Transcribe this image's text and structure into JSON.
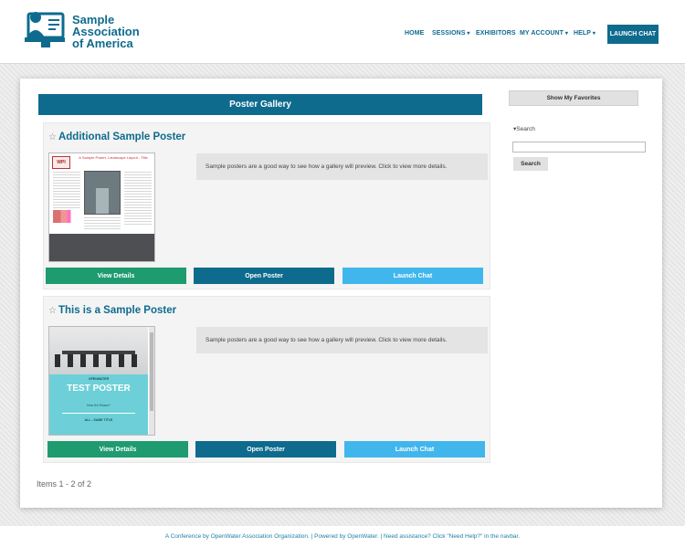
{
  "brand": {
    "name_line1": "Sample",
    "name_line2": "Association",
    "name_line3": "of America",
    "color": "#0e6b8e"
  },
  "nav": {
    "home": "HOME",
    "sessions": "SESSIONS",
    "exhibitors": "EXHIBITORS",
    "my_account": "MY ACCOUNT",
    "help": "HELP",
    "launch_chat": "LAUNCH CHAT"
  },
  "gallery": {
    "title": "Poster Gallery",
    "items_count": "Items 1 - 2 of 2",
    "posters": [
      {
        "title": "Additional Sample Poster",
        "description": "Sample posters are a good way to see how a gallery will preview. Click to view more details.",
        "thumb_seal": "WPI",
        "thumb_title": "A Sample Poster, Landscape Layout - Title",
        "view_details": "View Details",
        "open_poster": "Open Poster",
        "launch_chat": "Launch Chat"
      },
      {
        "title": "This is a Sample Poster",
        "description": "Sample posters are a good way to see how a gallery will preview. Click to view more details.",
        "thumb_brand": "OPENWATER",
        "thumb_title": "TEST POSTER",
        "thumb_subtitle": "How It's Shown?",
        "thumb_footer": "ALL - SAME TITLE",
        "view_details": "View Details",
        "open_poster": "Open Poster",
        "launch_chat": "Launch Chat"
      }
    ]
  },
  "sidebar": {
    "favorites_label": "Show My Favorites",
    "search_label": "Search",
    "search_value": "",
    "search_button": "Search"
  },
  "footer": {
    "text": "A Conference by OpenWater Association Organization. | Powered by OpenWater. | Need assistance? Click \"Need Help?\" in the navbar."
  },
  "colors": {
    "primary": "#0e6b8e",
    "green": "#1f9b70",
    "light_blue": "#41b6ec"
  }
}
